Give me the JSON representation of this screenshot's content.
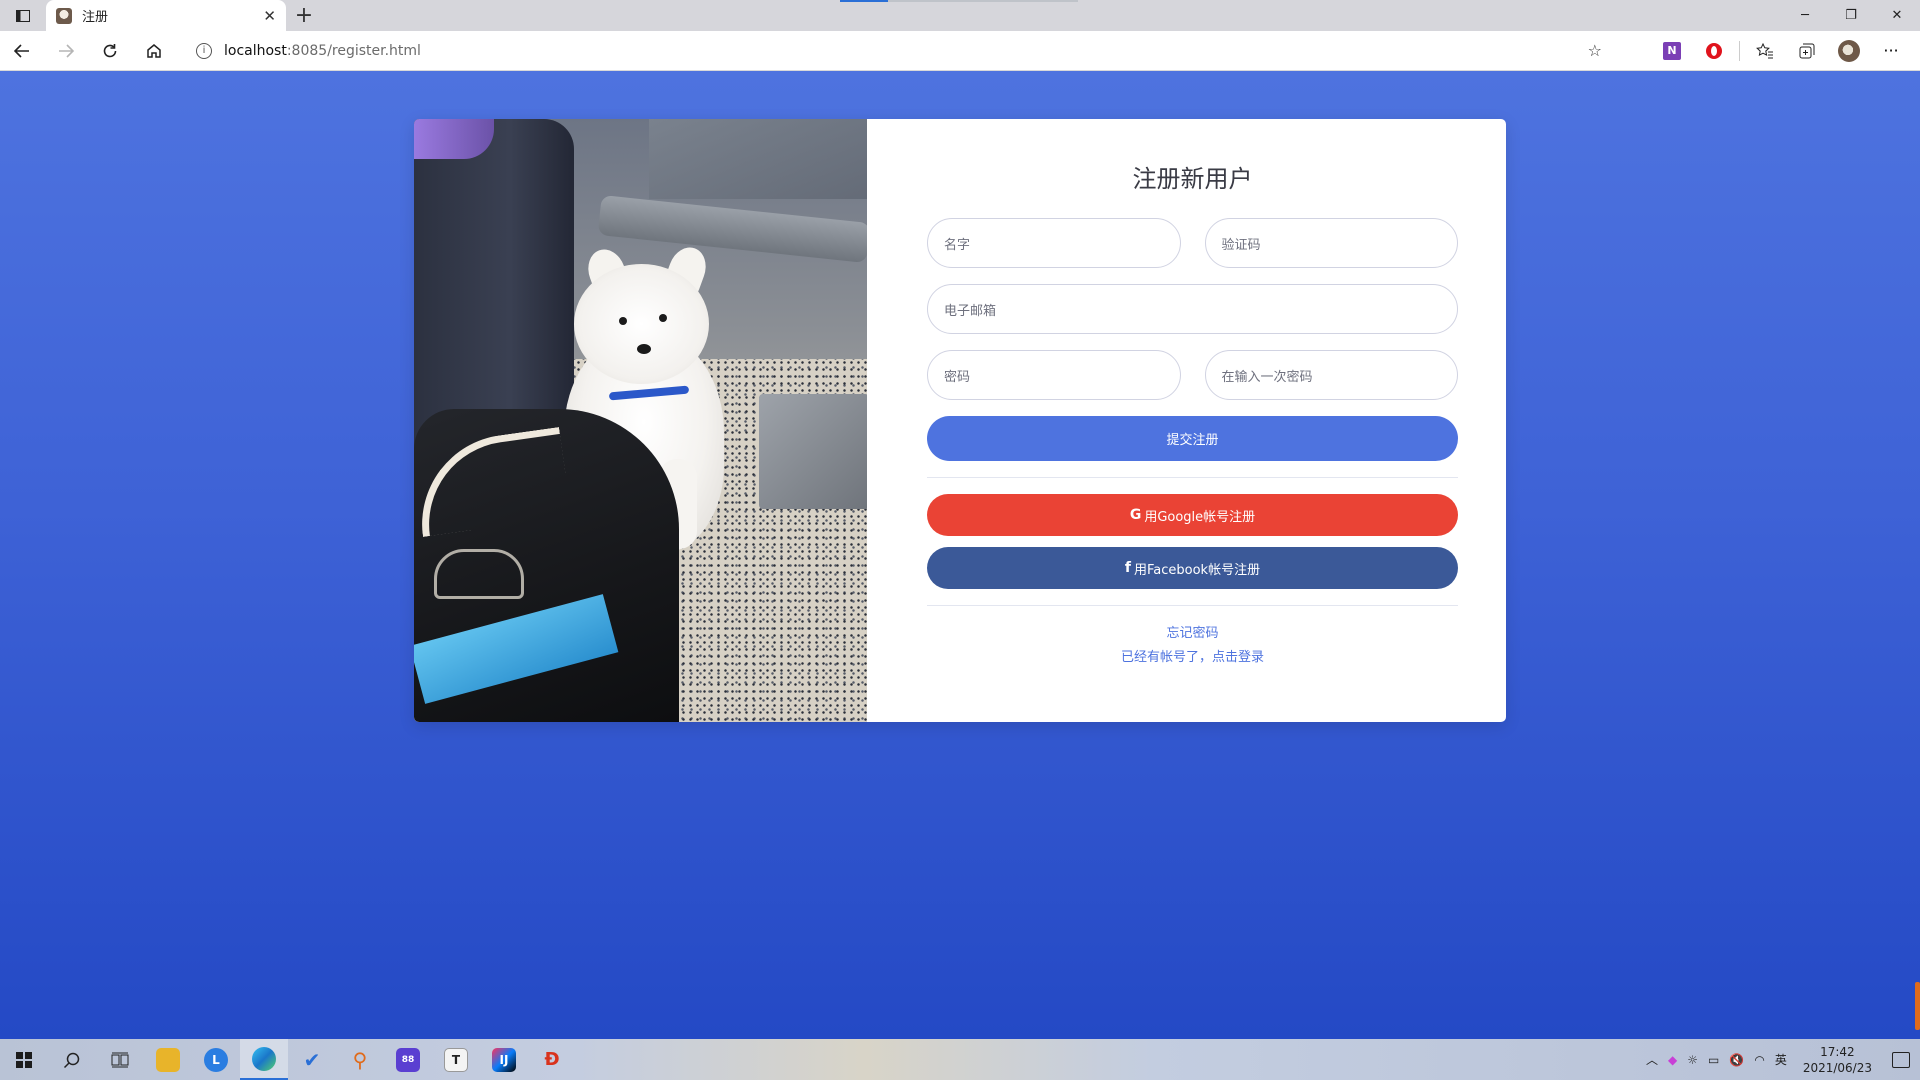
{
  "browser": {
    "tab_title": "注册",
    "tab_close": "✕",
    "new_tab": "+",
    "url_host": "localhost",
    "url_rest": ":8085/register.html",
    "window_minimize": "─",
    "window_restore": "❐",
    "window_close": "✕",
    "more_menu": "···"
  },
  "form": {
    "title": "注册新用户",
    "first_name_placeholder": "名字",
    "captcha_placeholder": "验证码",
    "email_placeholder": "电子邮箱",
    "password_placeholder": "密码",
    "repeat_password_placeholder": "在输入一次密码",
    "submit_label": "提交注册",
    "google_icon": "G",
    "google_label": "用Google帐号注册",
    "facebook_icon": "f",
    "facebook_label": "用Facebook帐号注册",
    "forgot_link": "忘记密码",
    "login_link": "已经有帐号了，点击登录"
  },
  "taskbar": {
    "time": "17:42",
    "date": "2021/06/23",
    "ime": "英"
  },
  "colors": {
    "primary": "#4e73df",
    "google": "#ea4335",
    "facebook": "#3b5998"
  }
}
